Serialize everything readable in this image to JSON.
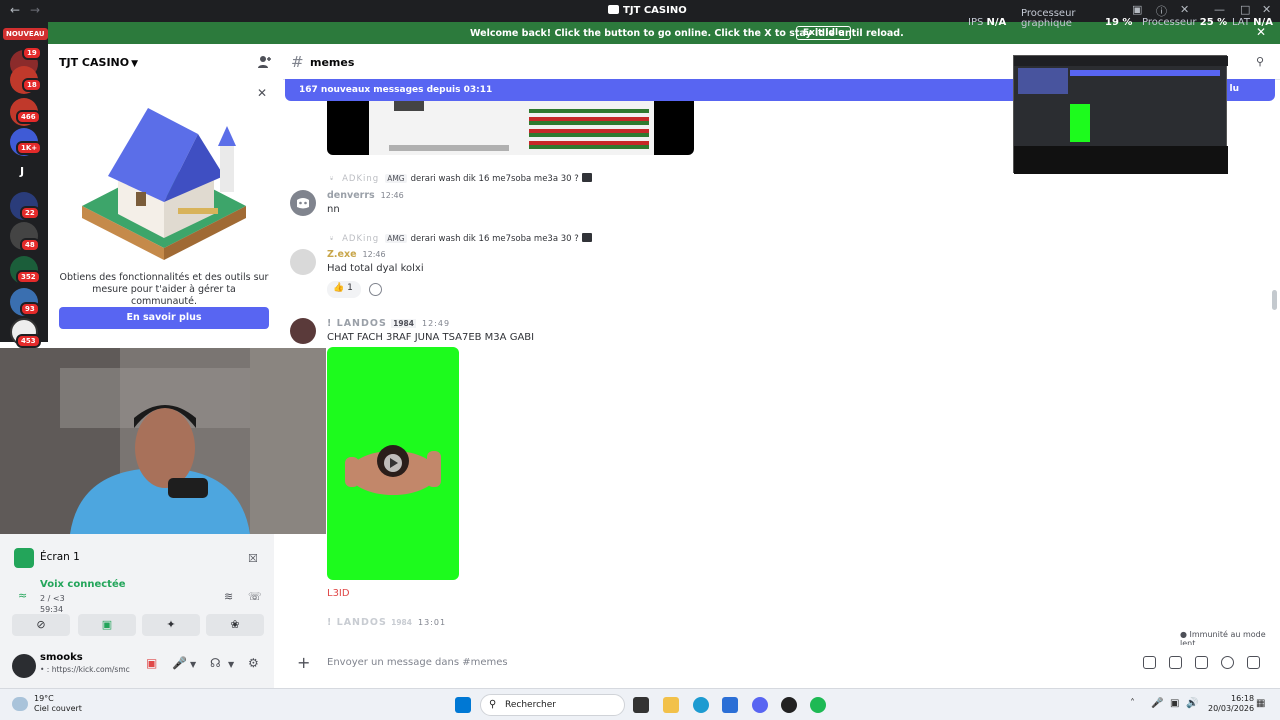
{
  "app": {
    "window_title": "TJT CASINO"
  },
  "banner": {
    "text": "Welcome back! Click the button to go online. Click the X to stay idle until reload.",
    "button": "Exit idle"
  },
  "hud": {
    "ips_label": "IPS",
    "ips_value": "N/A",
    "gpu_label": "Processeur graphique",
    "gpu_value": "19 %",
    "cpu_label": "Processeur",
    "cpu_value": "25 %",
    "lat_label": "LAT",
    "lat_value": "N/A"
  },
  "rail": {
    "new_label": "NOUVEAU",
    "badges": [
      "19",
      "18",
      "466",
      "1K+",
      "22",
      "48",
      "352",
      "93",
      "453"
    ],
    "letter": "J"
  },
  "server": {
    "name": "TJT CASINO",
    "promo_text": "Obtiens des fonctionnalités et des outils sur mesure pour t'aider à gérer ta communauté.",
    "promo_button": "En savoir plus"
  },
  "channel": {
    "name": "memes",
    "new_messages": "167 nouveaux messages depuis 03:11",
    "new_messages_mark": "lu"
  },
  "messages": [
    {
      "reply_user": "ADKing",
      "reply_tag": "AMG",
      "reply_text": "derari wash dik 16 me7soba me3a 30 ?",
      "user": "denverrs",
      "time": "12:46",
      "text": "nn"
    },
    {
      "reply_user": "ADKing",
      "reply_tag": "AMG",
      "reply_text": "derari wash dik 16 me7soba me3a 30 ?",
      "user": "Z.exe",
      "time": "12:46",
      "text": "Had total dyal kolxi",
      "reaction_count": "1"
    },
    {
      "user": "! LANDOS",
      "user_tag": "1984",
      "time": "12:49",
      "text": "CHAT FACH 3RAF JUNA TSA7EB M3A GABI",
      "footer": "L3ID"
    },
    {
      "user": "! LANDOS",
      "user_tag": "1984",
      "time": "13:01"
    }
  ],
  "composer": {
    "placeholder": "Envoyer un message dans #memes"
  },
  "status": {
    "immunity": "Immunité au mode lent"
  },
  "voice": {
    "screen_label": "Écran 1",
    "connected": "Voix connectée",
    "channel": "2 / <3",
    "duration": "59:34",
    "username": "smooks",
    "user_status": "• : https://kick.com/smc"
  },
  "taskbar": {
    "temp": "19°C",
    "weather": "Ciel couvert",
    "search_placeholder": "Rechercher",
    "time": "16:18",
    "date": "20/03/2026"
  },
  "colors": {
    "blurple": "#5865f2",
    "banner_green": "#2c7a3c",
    "online_green": "#23a55a",
    "badge_red": "#e42a2a"
  }
}
